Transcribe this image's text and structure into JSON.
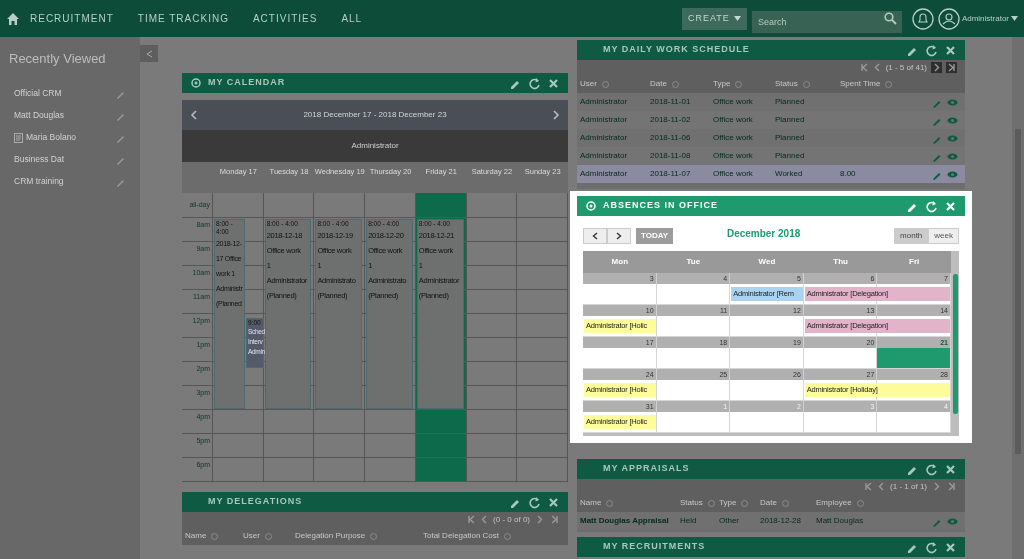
{
  "nav": {
    "items": [
      "RECRUITMENT",
      "TIME TRACKING",
      "ACTIVITIES",
      "ALL"
    ],
    "create": "CREATE",
    "search": {
      "placeholder": "Search"
    },
    "user": "Administrator"
  },
  "sidebar": {
    "title": "Recently Viewed",
    "items": [
      {
        "label": "Official CRM",
        "kind": "plain"
      },
      {
        "label": "Matt Douglas",
        "kind": "plain"
      },
      {
        "label": "Maria Bolano",
        "kind": "document"
      },
      {
        "label": "Business Dat",
        "kind": "plain"
      },
      {
        "label": "CRM training",
        "kind": "plain"
      }
    ]
  },
  "my_calendar": {
    "title": "MY CALENDAR",
    "range": "2018 December 17 - 2018 December 23",
    "resource": "Administrator",
    "hours": [
      "8am",
      "9am",
      "10am",
      "11am",
      "12pm",
      "1pm",
      "2pm",
      "3pm",
      "4pm",
      "5pm",
      "6pm"
    ],
    "all_day": "all-day",
    "days": [
      {
        "label": "Monday 17",
        "today": false,
        "events": [
          {
            "kind": "main",
            "narrow": true,
            "time": "8:00 - 4:00",
            "lines": [
              "2018-12-",
              "17 Office",
              "work 1",
              "Administr",
              "(Planned"
            ]
          },
          {
            "kind": "overlap",
            "time": "9:00",
            "lines": [
              "Sched",
              "Interv",
              "Admin"
            ]
          }
        ]
      },
      {
        "label": "Tuesday 18",
        "today": false,
        "events": [
          {
            "kind": "main",
            "narrow": false,
            "time": "8:00 - 4:00",
            "lines": [
              "2018-12-18",
              "Office work",
              "1",
              "Administrator",
              "(Planned)"
            ]
          }
        ]
      },
      {
        "label": "Wednesday 19",
        "today": false,
        "events": [
          {
            "kind": "main",
            "narrow": false,
            "time": "8:00 - 4:00",
            "lines": [
              "2018-12-19",
              "Office work",
              "1",
              "Administrato",
              "(Planned)"
            ]
          }
        ]
      },
      {
        "label": "Thursday 20",
        "today": false,
        "events": [
          {
            "kind": "main",
            "narrow": false,
            "time": "8:00 - 4:00",
            "lines": [
              "2018-12-20",
              "Office work",
              "1",
              "Administrato",
              "(Planned)"
            ]
          }
        ]
      },
      {
        "label": "Friday 21",
        "today": true,
        "events": [
          {
            "kind": "main",
            "narrow": false,
            "time": "8:00 - 4:00",
            "lines": [
              "2018-12-21",
              "Office work",
              "1",
              "Administrator",
              "(Planned)"
            ]
          }
        ]
      },
      {
        "label": "Saturday 22",
        "today": false
      },
      {
        "label": "Sunday 23",
        "today": false
      }
    ]
  },
  "my_delegations": {
    "title": "MY DELEGATIONS",
    "pager": "(0 - 0 of 0)",
    "columns": [
      "Name",
      "User",
      "Delegation Purpose",
      "Total Delegation Cost"
    ]
  },
  "daily_work_schedule": {
    "title": "MY DAILY WORK SCHEDULE",
    "pager": "(1 - 5 of 41)",
    "columns": [
      "User",
      "Date",
      "Type",
      "Status",
      "Spent Time"
    ],
    "rows": [
      {
        "cells": [
          "Administrator",
          "2018-11-01",
          "Office work",
          "Planned",
          ""
        ],
        "selected": false
      },
      {
        "cells": [
          "Administrator",
          "2018-11-02",
          "Office work",
          "Planned",
          ""
        ],
        "selected": false
      },
      {
        "cells": [
          "Administrator",
          "2018-11-06",
          "Office work",
          "Planned",
          ""
        ],
        "selected": false
      },
      {
        "cells": [
          "Administrator",
          "2018-11-08",
          "Office work",
          "Planned",
          ""
        ],
        "selected": false
      },
      {
        "cells": [
          "Administrator",
          "2018-11-07",
          "Office work",
          "Worked",
          "8.00"
        ],
        "selected": true
      }
    ]
  },
  "absences": {
    "title": "ABSENCES IN OFFICE",
    "today_button": "TODAY",
    "month_title": "December 2018",
    "views": [
      {
        "label": "month",
        "selected": true
      },
      {
        "label": "week",
        "selected": false
      }
    ],
    "weekdays": [
      "Mon",
      "Tue",
      "Wed",
      "Thu",
      "Fri"
    ],
    "weeks": [
      {
        "days": [
          {
            "day": "3",
            "other_month": false,
            "today": false
          },
          {
            "day": "4",
            "other_month": false,
            "today": false
          },
          {
            "day": "5",
            "other_month": false,
            "today": false,
            "event": {
              "label": "Administrator [Rem",
              "color": "#a9d3ef",
              "wide": false
            }
          },
          {
            "day": "6",
            "other_month": false,
            "today": false,
            "event": {
              "label": "Administrator [Delegation]",
              "color": "#e3b4c9",
              "wide": true
            }
          },
          {
            "day": "7",
            "other_month": false,
            "today": false
          }
        ]
      },
      {
        "days": [
          {
            "day": "10",
            "other_month": false,
            "today": false,
            "event": {
              "label": "Administrator [Holic",
              "color": "#fcfc9a",
              "wide": false
            }
          },
          {
            "day": "11",
            "other_month": false,
            "today": false
          },
          {
            "day": "12",
            "other_month": false,
            "today": false
          },
          {
            "day": "13",
            "other_month": false,
            "today": false,
            "event": {
              "label": "Administrator [Delegation]",
              "color": "#e3b4c9",
              "wide": true
            }
          },
          {
            "day": "14",
            "other_month": false,
            "today": false
          }
        ]
      },
      {
        "days": [
          {
            "day": "17",
            "other_month": false,
            "today": false
          },
          {
            "day": "18",
            "other_month": false,
            "today": false
          },
          {
            "day": "19",
            "other_month": false,
            "today": false
          },
          {
            "day": "20",
            "other_month": false,
            "today": false
          },
          {
            "day": "21",
            "other_month": false,
            "today": true
          }
        ]
      },
      {
        "days": [
          {
            "day": "24",
            "other_month": false,
            "today": false,
            "event": {
              "label": "Administrator [Holic",
              "color": "#fcfc9a",
              "wide": false
            }
          },
          {
            "day": "25",
            "other_month": false,
            "today": false
          },
          {
            "day": "26",
            "other_month": false,
            "today": false
          },
          {
            "day": "27",
            "other_month": false,
            "today": false,
            "event": {
              "label": "Administrator [Holiday]",
              "color": "#fcfc9a",
              "wide": true
            }
          },
          {
            "day": "28",
            "other_month": false,
            "today": false
          }
        ]
      },
      {
        "days": [
          {
            "day": "31",
            "other_month": false,
            "today": false,
            "event": {
              "label": "Administrator [Holic",
              "color": "#fcfc9a",
              "wide": false
            }
          },
          {
            "day": "1",
            "other_month": true,
            "today": false
          },
          {
            "day": "2",
            "other_month": true,
            "today": false
          },
          {
            "day": "3",
            "other_month": true,
            "today": false
          },
          {
            "day": "4",
            "other_month": true,
            "today": false
          }
        ]
      }
    ]
  },
  "my_appraisals": {
    "title": "MY APPRAISALS",
    "pager": "(1 - 1 of 1)",
    "columns": [
      "Name",
      "Status",
      "Type",
      "Date",
      "Employee"
    ],
    "rows": [
      {
        "cells": [
          "Matt Douglas Appraisal",
          "Held",
          "Other",
          "2018-12-28",
          "Matt Douglas"
        ],
        "selected": false
      }
    ]
  },
  "my_recruitments": {
    "title": "MY RECRUITMENTS"
  }
}
